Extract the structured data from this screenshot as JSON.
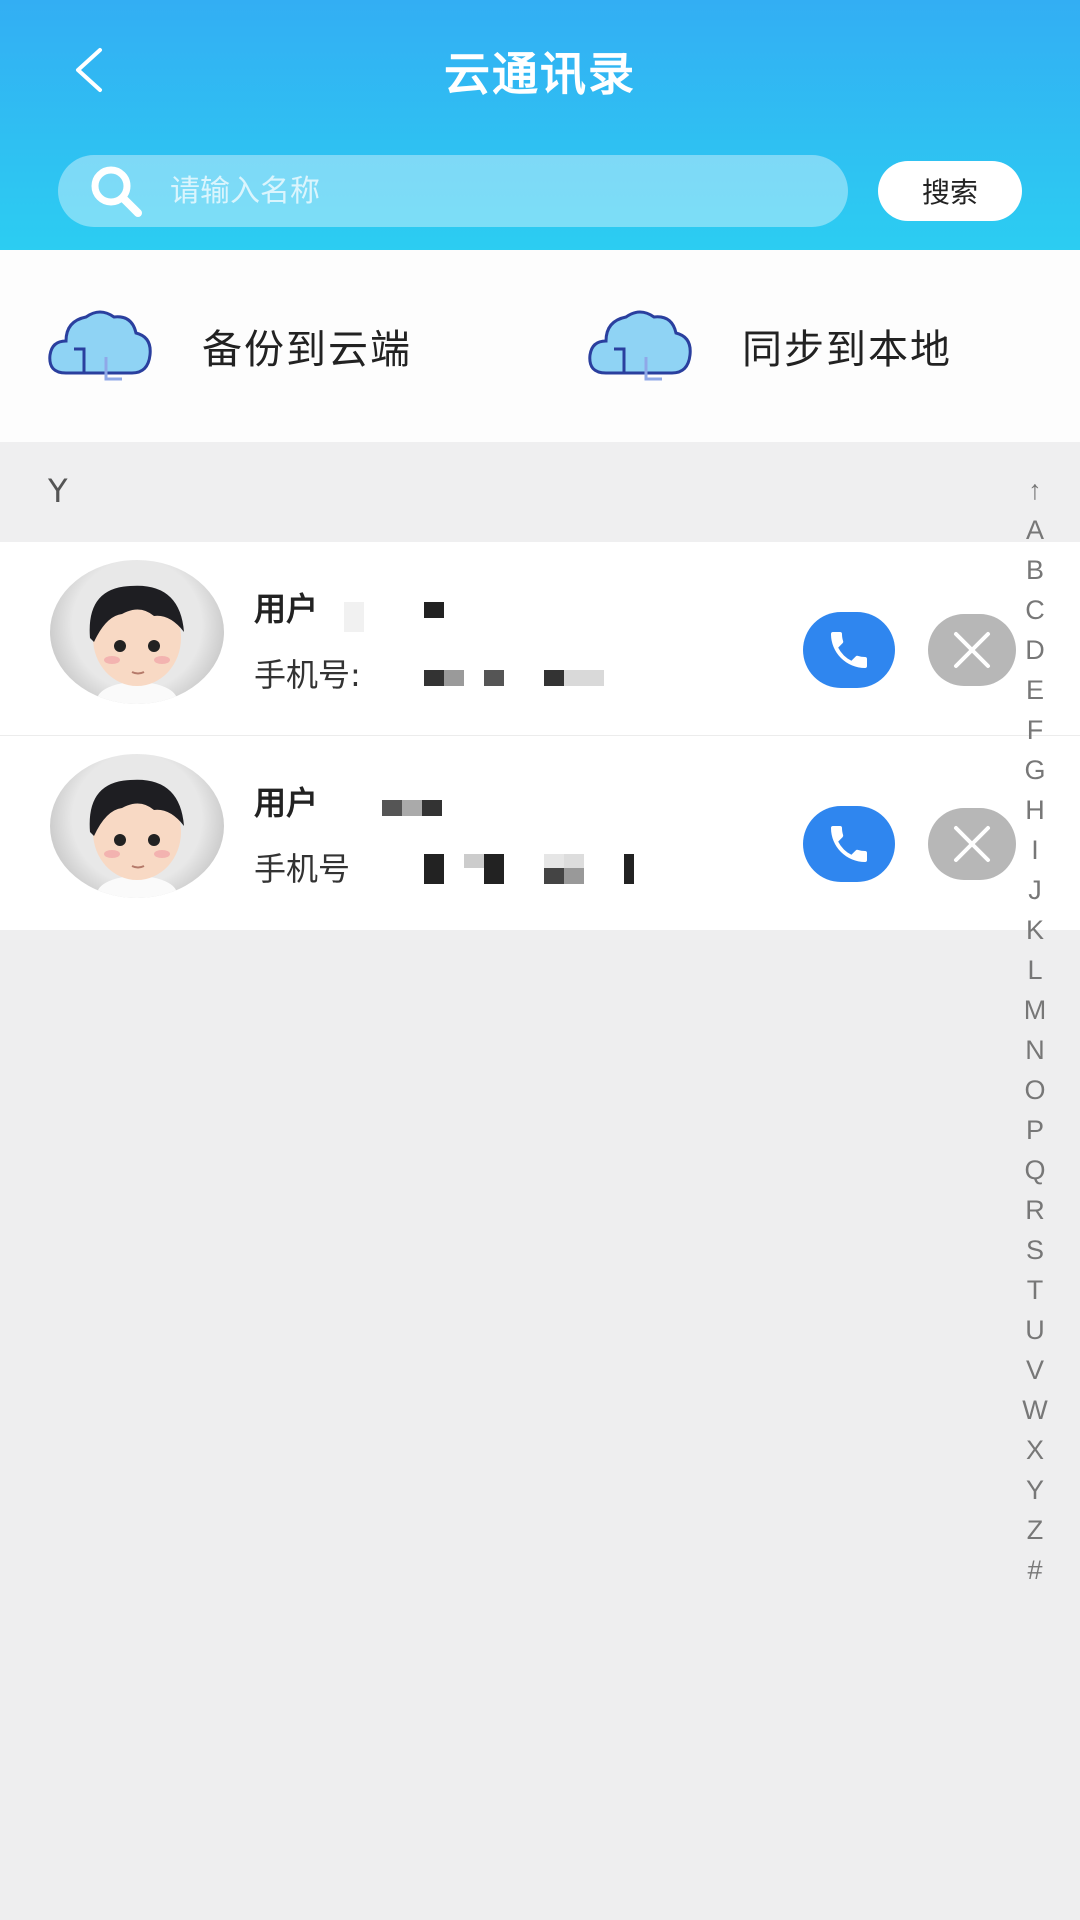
{
  "header": {
    "title": "云通讯录",
    "search_placeholder": "请输入名称",
    "search_button": "搜索"
  },
  "actions": [
    {
      "label": "备份到云端",
      "icon": "cloud-upload-icon"
    },
    {
      "label": "同步到本地",
      "icon": "cloud-download-icon"
    }
  ],
  "section": {
    "letter": "Y"
  },
  "contacts": [
    {
      "name_prefix": "用户",
      "phone_prefix": "手机号:"
    },
    {
      "name_prefix": "用户",
      "phone_prefix": "手机号"
    }
  ],
  "index_letters": [
    "↑",
    "A",
    "B",
    "C",
    "D",
    "E",
    "F",
    "G",
    "H",
    "I",
    "J",
    "K",
    "L",
    "M",
    "N",
    "O",
    "P",
    "Q",
    "R",
    "S",
    "T",
    "U",
    "V",
    "W",
    "X",
    "Y",
    "Z",
    "#"
  ],
  "colors": {
    "header_top": "#33aef3",
    "header_bottom": "#2ccdf2",
    "call": "#2f86ef",
    "delete": "#b7b7b7"
  }
}
